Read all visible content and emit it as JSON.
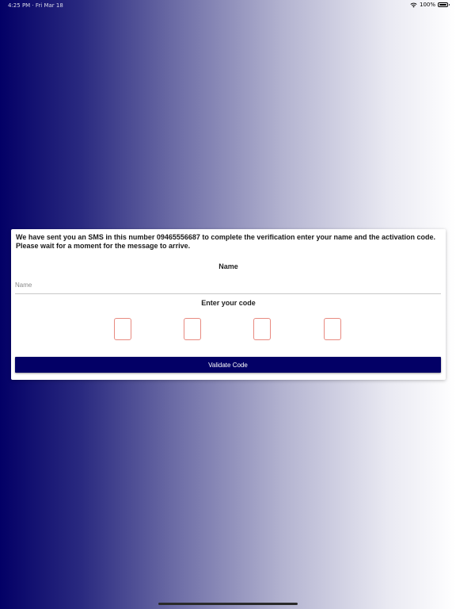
{
  "status_bar": {
    "time_date": "4:25 PM · Fri Mar 18",
    "battery_percent": "100%"
  },
  "form": {
    "message": "We have sent you an SMS in this number 09465556687 to complete the verification enter your name and the activation code. Please wait for a moment for the message to arrive.",
    "name_label": "Name",
    "name_placeholder": "Name",
    "name_value": "",
    "code_label": "Enter your code",
    "code_digits": [
      "",
      "",
      "",
      ""
    ],
    "validate_label": "Validate Code"
  },
  "colors": {
    "primary": "#030066",
    "code_box_border": "#e88a80",
    "card_background": "#ffffff"
  },
  "icons": [
    "wifi-icon",
    "battery-icon"
  ]
}
